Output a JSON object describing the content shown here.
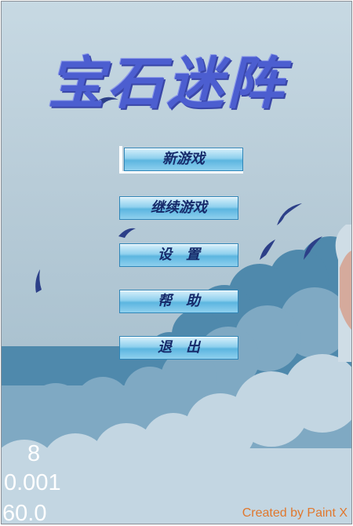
{
  "title": "宝石迷阵",
  "menu": {
    "new_game": "新游戏",
    "continue_game": "继续游戏",
    "settings": "设　置",
    "help": "帮　助",
    "exit": "退　出"
  },
  "stats": {
    "line1": "8",
    "line2": "0.001",
    "line3": "60.0"
  },
  "credit": "Created by Paint X",
  "colors": {
    "title": "#4c5ed0",
    "button_text": "#162a6a",
    "credit": "#e0782e",
    "cloud_dark": "#4f89ac",
    "cloud_mid": "#7fa9c3",
    "cloud_light": "#c3d6e2",
    "bird": "#2c3f88"
  }
}
